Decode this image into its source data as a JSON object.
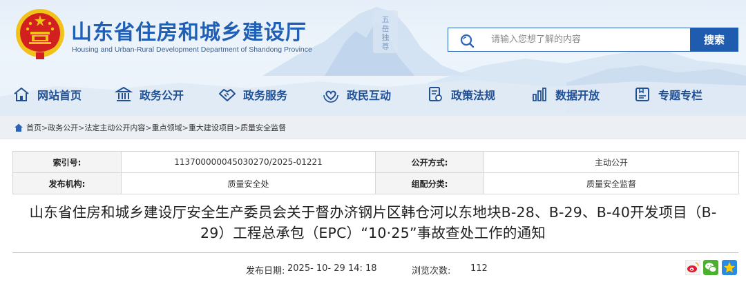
{
  "header": {
    "site_title": "山东省住房和城乡建设厅",
    "site_subtitle": "Housing and Urban-Rural Development Department of Shandong Province",
    "decor_text": "五岳独尊"
  },
  "search": {
    "placeholder": "请输入您想了解的内容",
    "button_label": "搜索"
  },
  "nav": {
    "items": [
      {
        "label": "网站首页",
        "icon": "home-icon"
      },
      {
        "label": "政务公开",
        "icon": "government-building-icon"
      },
      {
        "label": "政务服务",
        "icon": "handshake-icon"
      },
      {
        "label": "政民互动",
        "icon": "heart-hands-icon"
      },
      {
        "label": "政策法规",
        "icon": "policy-document-icon"
      },
      {
        "label": "数据开放",
        "icon": "data-chart-icon"
      },
      {
        "label": "专题专栏",
        "icon": "topic-column-icon"
      }
    ]
  },
  "breadcrumb": [
    "首页",
    "政务公开",
    "法定主动公开内容",
    "重点领域",
    "重大建设项目",
    "质量安全监督"
  ],
  "info": {
    "index_label": "索引号:",
    "index_value": "113700000045030270/2025-01221",
    "disclosure_label": "公开方式:",
    "disclosure_value": "主动公开",
    "issuer_label": "发布机构:",
    "issuer_value": "质量安全处",
    "category_label": "组配分类:",
    "category_value": "质量安全监督"
  },
  "article": {
    "title_line1": "山东省住房和城乡建设厅安全生产委员会关于督办济钢片区韩仓河以东地块B-28、B-29、B-40开发项目（B-",
    "title_line2": "29）工程总承包（EPC）“10·25”事故查处工作的通知",
    "publish_label": "发布日期:",
    "publish_date": "2025- 10- 29 14: 18",
    "views_label": "浏览次数:",
    "views_count": "112"
  },
  "share": [
    "weibo-icon",
    "wechat-icon",
    "qzone-icon"
  ],
  "colors": {
    "brand_blue": "#1f5fb5",
    "nav_text": "#1f4f94",
    "search_button": "#1f5cb0",
    "emblem_red": "#d21f1f",
    "emblem_gold": "#f3c218"
  }
}
